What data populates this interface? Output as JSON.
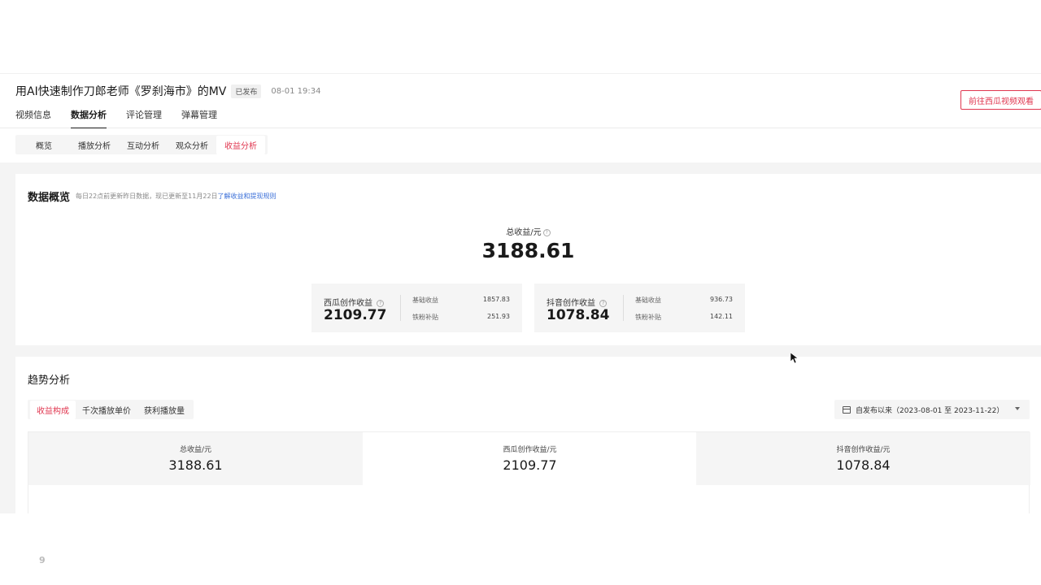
{
  "header": {
    "title": "用AI快速制作刀郎老师《罗刹海市》的MV",
    "badge": "已发布",
    "time": "08-01 19:34",
    "tabs": [
      {
        "label": "视频信息"
      },
      {
        "label": "数据分析"
      },
      {
        "label": "评论管理"
      },
      {
        "label": "弹幕管理"
      }
    ],
    "active_tab": "数据分析",
    "watch_button": "前往西瓜视频观看"
  },
  "subnav": {
    "items": [
      {
        "label": "概览"
      },
      {
        "label": "播放分析"
      },
      {
        "label": "互动分析"
      },
      {
        "label": "观众分析"
      },
      {
        "label": "收益分析"
      }
    ],
    "active": "收益分析"
  },
  "overview": {
    "title": "数据概览",
    "note": "每日22点前更新昨日数据，现已更新至11月22日",
    "note_link": "了解收益和提现规则",
    "total_label": "总收益/元",
    "total_value": "3188.61",
    "cards": [
      {
        "label": "西瓜创作收益",
        "value": "2109.77",
        "rows": [
          {
            "label": "基础收益",
            "value": "1857.83"
          },
          {
            "label": "铁粉补贴",
            "value": "251.93"
          }
        ]
      },
      {
        "label": "抖音创作收益",
        "value": "1078.84",
        "rows": [
          {
            "label": "基础收益",
            "value": "936.73"
          },
          {
            "label": "铁粉补贴",
            "value": "142.11"
          }
        ]
      }
    ]
  },
  "trend": {
    "title": "趋势分析",
    "metric_tabs": [
      {
        "label": "收益构成"
      },
      {
        "label": "千次播放单价"
      },
      {
        "label": "获利播放量"
      }
    ],
    "active_metric": "收益构成",
    "date_range": "自发布以来（2023-08-01  至  2023-11-22）",
    "summary": [
      {
        "label": "总收益/元",
        "value": "3188.61"
      },
      {
        "label": "西瓜创作收益/元",
        "value": "2109.77"
      },
      {
        "label": "抖音创作收益/元",
        "value": "1078.84"
      }
    ]
  },
  "page_number": "9",
  "colors": {
    "accent": "#e0364f",
    "link": "#3a6fd8",
    "panel_bg": "#f5f5f5"
  }
}
